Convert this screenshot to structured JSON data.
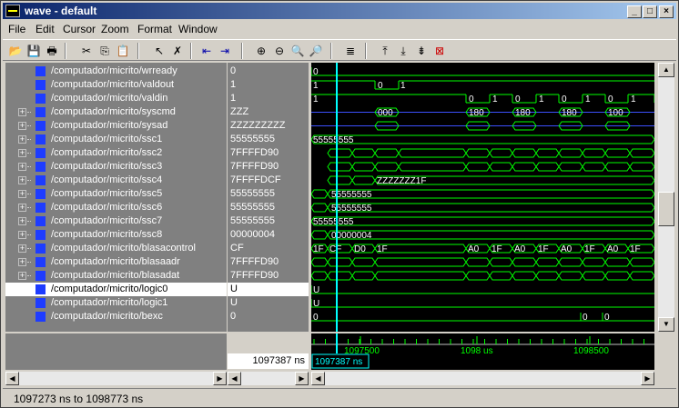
{
  "window": {
    "title": "wave - default",
    "min": "_",
    "max": "□",
    "close": "×"
  },
  "menu": [
    "File",
    "Edit",
    "Cursor",
    "Zoom",
    "Format",
    "Window"
  ],
  "toolbar_icons": [
    "open-icon",
    "save-icon",
    "print-icon",
    "cut-icon",
    "copy-icon",
    "paste-icon",
    "select-icon",
    "delete-icon",
    "cursor-left-icon",
    "cursor-right-icon",
    "zoom-in-icon",
    "zoom-out-icon",
    "zoom-full-icon",
    "zoom-cursor-icon",
    "format-icon",
    "edge-left-icon",
    "edge-right-icon",
    "find-icon",
    "clear-icon"
  ],
  "signals": [
    {
      "name": "/computador/micrito/wrready",
      "value": "0",
      "exp": false
    },
    {
      "name": "/computador/micrito/valdout",
      "value": "1",
      "exp": false
    },
    {
      "name": "/computador/micrito/valdin",
      "value": "1",
      "exp": false
    },
    {
      "name": "/computador/micrito/syscmd",
      "value": "ZZZ",
      "exp": true
    },
    {
      "name": "/computador/micrito/sysad",
      "value": "ZZZZZZZZZ",
      "exp": true
    },
    {
      "name": "/computador/micrito/ssc1",
      "value": "55555555",
      "exp": true
    },
    {
      "name": "/computador/micrito/ssc2",
      "value": "7FFFFD90",
      "exp": true
    },
    {
      "name": "/computador/micrito/ssc3",
      "value": "7FFFFD90",
      "exp": true
    },
    {
      "name": "/computador/micrito/ssc4",
      "value": "7FFFFDCF",
      "exp": true
    },
    {
      "name": "/computador/micrito/ssc5",
      "value": "55555555",
      "exp": true
    },
    {
      "name": "/computador/micrito/ssc6",
      "value": "55555555",
      "exp": true
    },
    {
      "name": "/computador/micrito/ssc7",
      "value": "55555555",
      "exp": true
    },
    {
      "name": "/computador/micrito/ssc8",
      "value": "00000004",
      "exp": true
    },
    {
      "name": "/computador/micrito/blasacontrol",
      "value": "CF",
      "exp": true
    },
    {
      "name": "/computador/micrito/blasaadr",
      "value": "7FFFFD90",
      "exp": true
    },
    {
      "name": "/computador/micrito/blasadat",
      "value": "7FFFFD90",
      "exp": true
    },
    {
      "name": "/computador/micrito/logic0",
      "value": "U",
      "exp": false,
      "selected": true
    },
    {
      "name": "/computador/micrito/logic1",
      "value": "U",
      "exp": false
    },
    {
      "name": "/computador/micrito/bexc",
      "value": "0",
      "exp": false
    }
  ],
  "wave_labels": {
    "wrready": [
      "0"
    ],
    "valdout": [
      "1",
      "0",
      "1"
    ],
    "valdin": [
      "1",
      "0",
      "1",
      "0",
      "1",
      "0",
      "1",
      "0",
      "1",
      "0",
      "1"
    ],
    "syscmd": [
      "000",
      "180",
      "180",
      "180",
      "100"
    ],
    "ssc1": [
      "55555555"
    ],
    "ssc4": [
      "ZZZZZZZ1F"
    ],
    "ssc5": [
      "55555555"
    ],
    "ssc6": [
      "55555555"
    ],
    "ssc7": [
      "55555555"
    ],
    "ssc8": [
      "00000004"
    ],
    "blasacontrol": [
      "1F",
      "CF",
      "D0",
      "1F",
      "A0",
      "1F",
      "A0",
      "1F",
      "A0",
      "1F",
      "A0",
      "1F"
    ],
    "logic0": [
      "U"
    ],
    "logic1": [
      "U"
    ],
    "bexc": [
      "0",
      "0",
      "0"
    ]
  },
  "timeline": {
    "ticks": [
      "1097500",
      "1098 us",
      "1098500"
    ],
    "cursor_time": "1097387 ns",
    "cursor_label": "1097387 ns"
  },
  "status": "1097273 ns to 1098773 ns",
  "colors": {
    "wave": "#00ff00",
    "cursor": "#00ffff",
    "text": "#ffffff",
    "signal_icon": "#1e3cff"
  }
}
